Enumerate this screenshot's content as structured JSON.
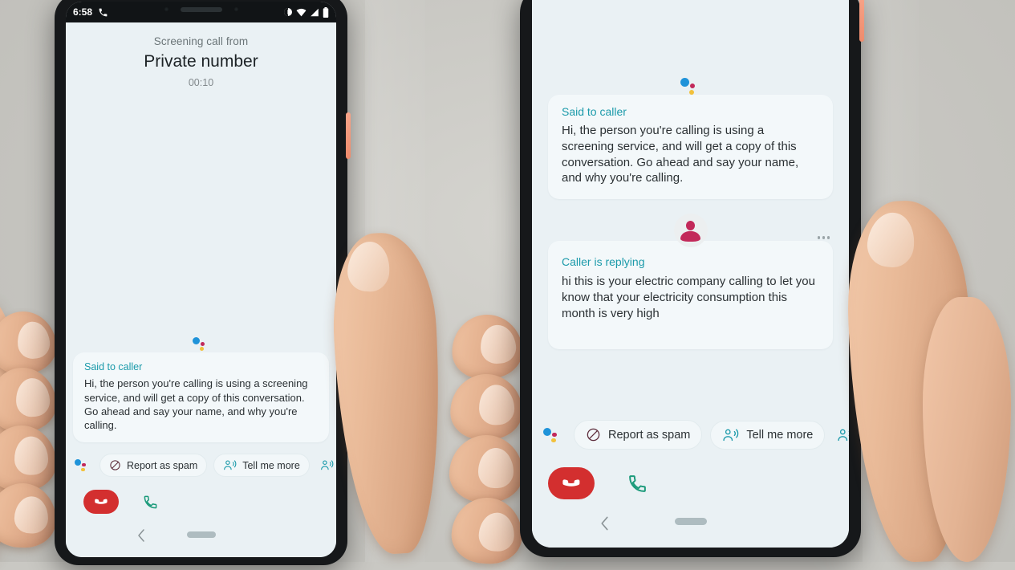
{
  "scene": {
    "description": "Two hands holding Pixel phones showing Google Call Screen",
    "background_color": "#c9c8c3",
    "screen_background": "#eaf1f4"
  },
  "status_bar": {
    "time": "6:58",
    "call_icon": "phone-in-call-icon",
    "icons": [
      "do-not-disturb-icon",
      "wifi-icon",
      "signal-icon",
      "battery-icon"
    ]
  },
  "left_phone": {
    "header": {
      "subtitle": "Screening call from",
      "caller_name": "Private number",
      "duration": "00:10"
    },
    "messages": [
      {
        "speaker": "assistant",
        "label": "Said to caller",
        "text": "Hi, the person you're calling is using a screening service, and will get a copy of this conversation. Go ahead and say your name, and why you're calling."
      }
    ],
    "chips": [
      {
        "icon": "assistant-dots-icon",
        "label": ""
      },
      {
        "icon": "block-circle-icon",
        "label": "Report as spam"
      },
      {
        "icon": "person-speaking-icon",
        "label": "Tell me more"
      },
      {
        "icon": "person-speaking-icon",
        "label": ""
      }
    ],
    "controls": {
      "end_call": "end-call-button",
      "answer_call": "answer-call-button"
    },
    "nav": {
      "back": "back-chevron-icon",
      "home": "home-pill-indicator"
    }
  },
  "right_phone": {
    "messages": [
      {
        "speaker": "assistant",
        "label": "Said to caller",
        "text": "Hi, the person you're calling is using a screening service, and will get a copy of this conversation. Go ahead and say your name, and why you're calling."
      },
      {
        "speaker": "caller",
        "label": "Caller is replying",
        "text": "hi this is your electric company calling to let you know that your electricity consumption this month is very high",
        "typing_indicator": "..."
      }
    ],
    "chips": [
      {
        "icon": "assistant-dots-icon",
        "label": ""
      },
      {
        "icon": "block-circle-icon",
        "label": "Report as spam"
      },
      {
        "icon": "person-speaking-icon",
        "label": "Tell me more"
      },
      {
        "icon": "person-speaking-icon",
        "label": ""
      }
    ],
    "controls": {
      "end_call": "end-call-button",
      "answer_call": "answer-call-button"
    },
    "nav": {
      "back": "back-chevron-icon",
      "home": "home-pill-indicator"
    }
  },
  "colors": {
    "accent_teal": "#1b9aaa",
    "end_call_red": "#d32f2f",
    "caller_crimson": "#c2295a",
    "assistant_blue": "#1f93d9",
    "assistant_yellow": "#f2c13c",
    "power_button_orange": "#f08a6a"
  }
}
